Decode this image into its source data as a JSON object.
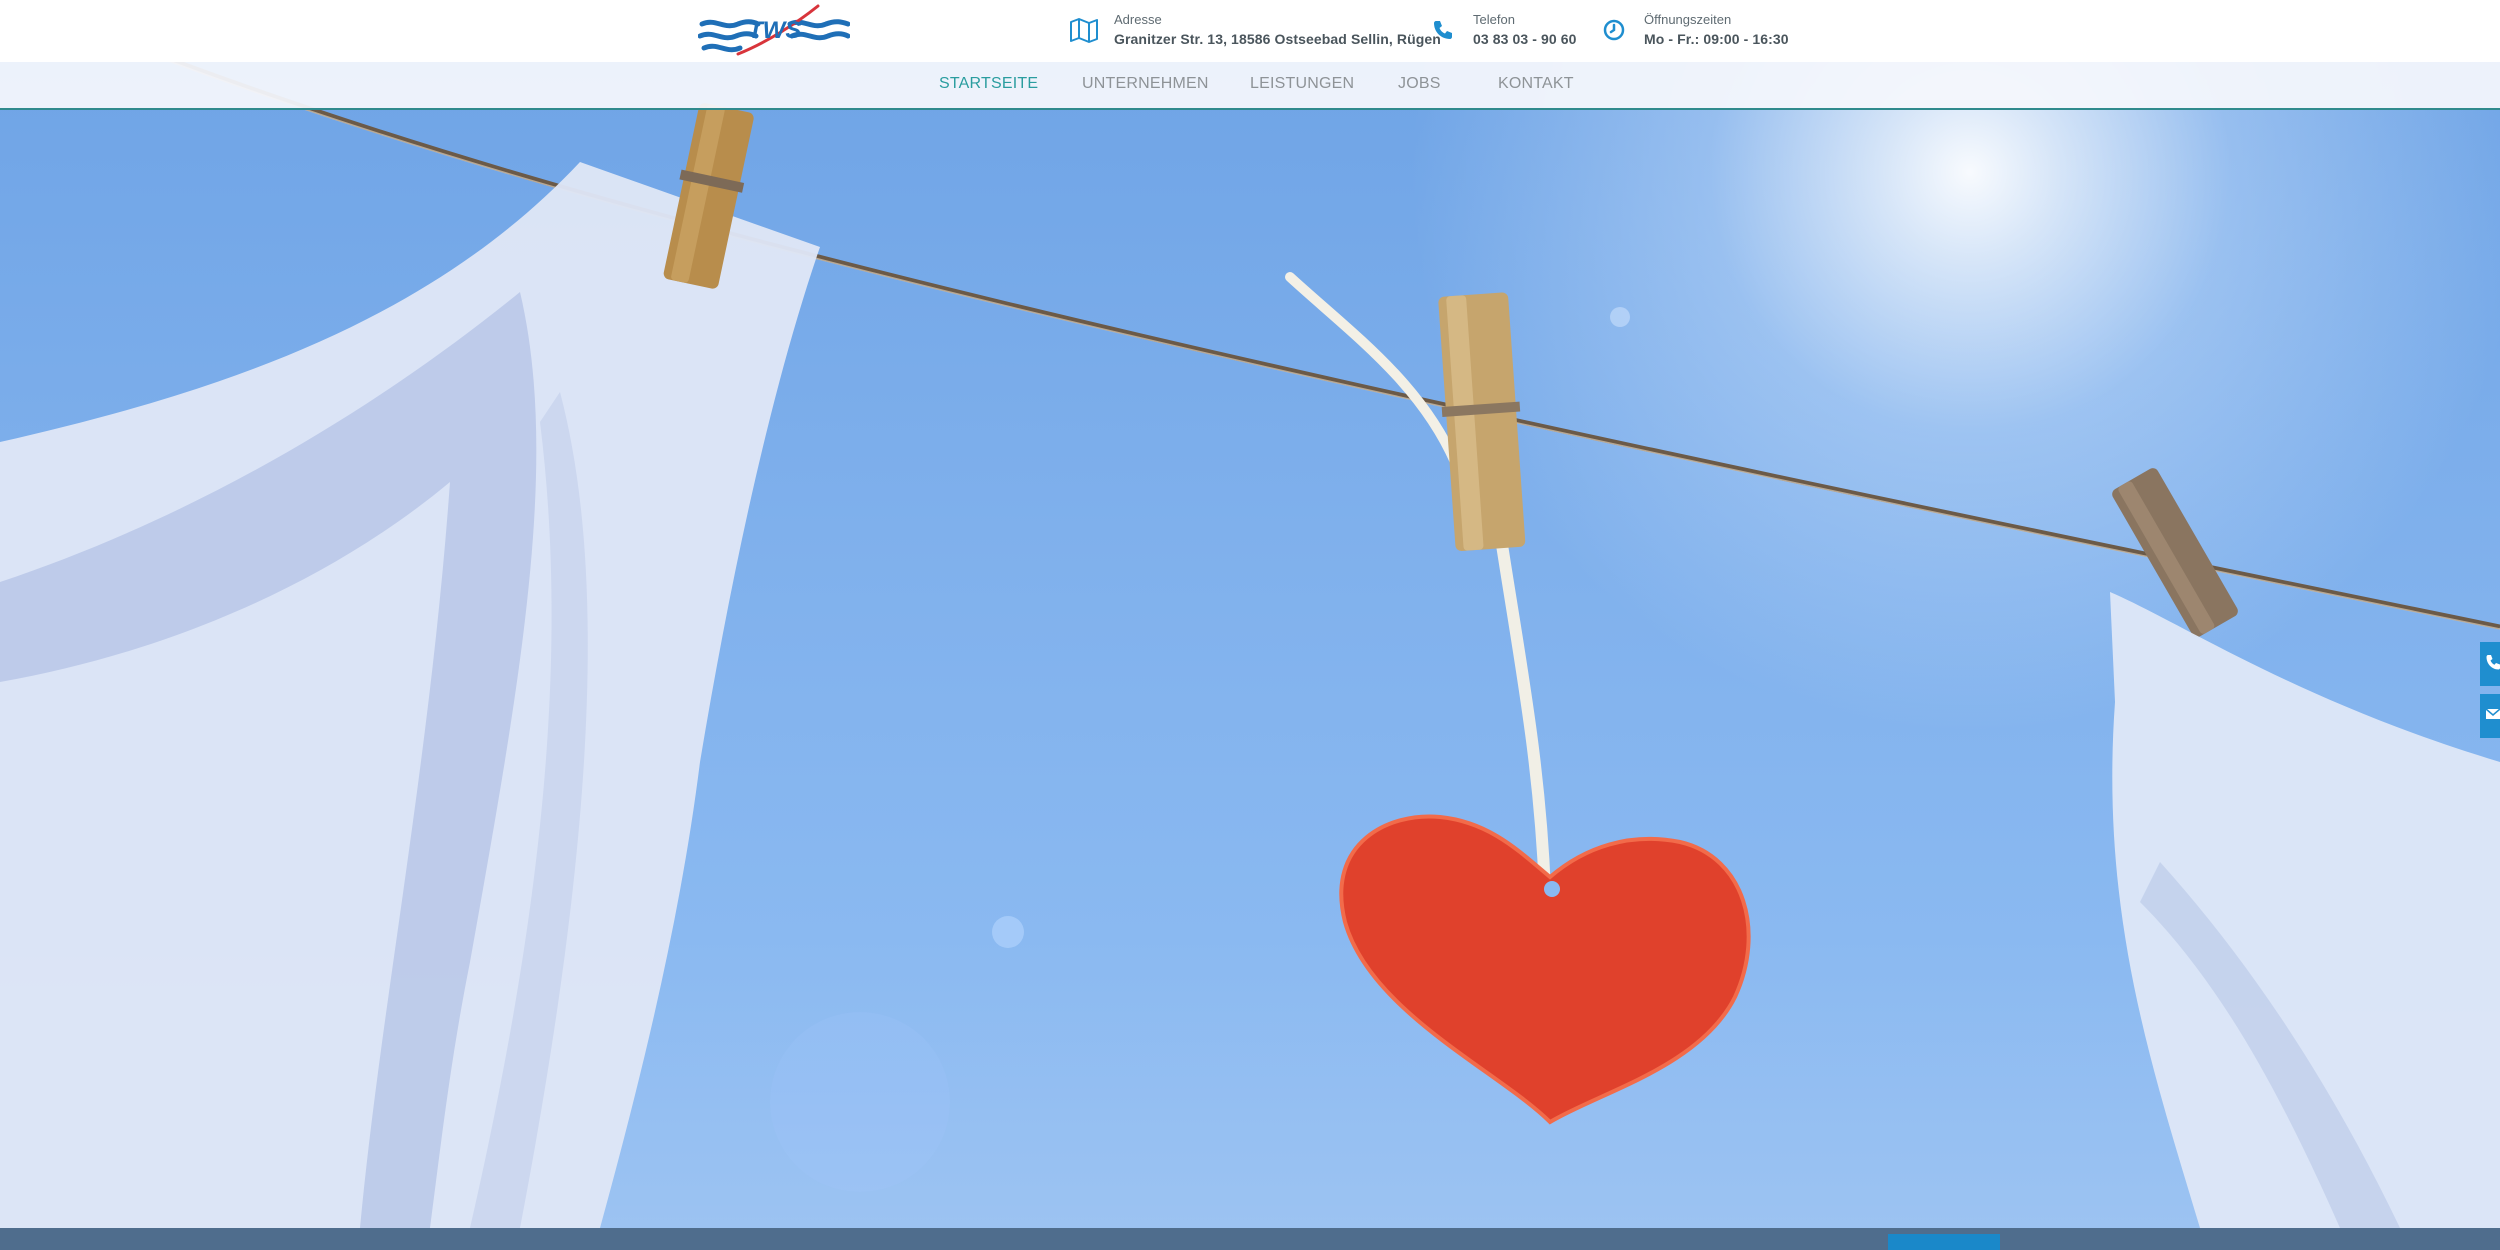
{
  "brand": {
    "logo_text": "TWS",
    "logo_colors": {
      "text": "#1f6fb7",
      "waves": "#1f6fb7",
      "swoosh": "#d8343b"
    }
  },
  "header": {
    "address": {
      "icon": "map-icon",
      "label": "Adresse",
      "value": "Granitzer Str. 13, 18586 Ostseebad Sellin, Rügen"
    },
    "phone": {
      "icon": "phone-icon",
      "label": "Telefon",
      "value": "03 83 03 - 90 60"
    },
    "hours": {
      "icon": "clock-icon",
      "label": "Öffnungszeiten",
      "value": "Mo - Fr.: 09:00 - 16:30"
    }
  },
  "nav": {
    "items": [
      {
        "label": "STARTSEITE",
        "active": true
      },
      {
        "label": "UNTERNEHMEN",
        "active": false
      },
      {
        "label": "LEISTUNGEN",
        "active": false
      },
      {
        "label": "JOBS",
        "active": false
      },
      {
        "label": "KONTAKT",
        "active": false
      }
    ],
    "active_color": "#2a9d9f",
    "text_color": "#8e9397"
  },
  "side_tabs": [
    {
      "icon": "phone-icon"
    },
    {
      "icon": "mail-icon"
    }
  ],
  "colors": {
    "accent": "#2a9d9f",
    "blue": "#1f8ecf",
    "bottom_bar": "#4f6d8d"
  }
}
